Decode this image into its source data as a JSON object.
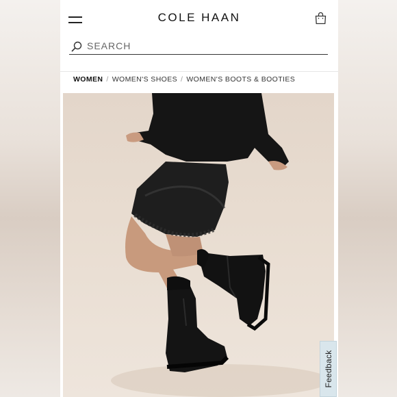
{
  "brand": {
    "logo_text": "COLE HAAN"
  },
  "search": {
    "placeholder": "SEARCH"
  },
  "breadcrumb": {
    "items": [
      "WOMEN",
      "WOMEN'S SHOES",
      "WOMEN'S BOOTS & BOOTIES"
    ],
    "separator": "/"
  },
  "icons": {
    "menu": "hamburger-menu-icon",
    "bag": "shopping-bag-icon",
    "search": "search-icon"
  },
  "hero": {
    "subject": "model seated wearing black top, black satin lace-trim skirt and black chelsea boots"
  },
  "feedback": {
    "label": "Feedback"
  },
  "colors": {
    "text": "#111111",
    "hero_background": "#e6d9cd",
    "feedback_tab": "#d9e6ec"
  }
}
